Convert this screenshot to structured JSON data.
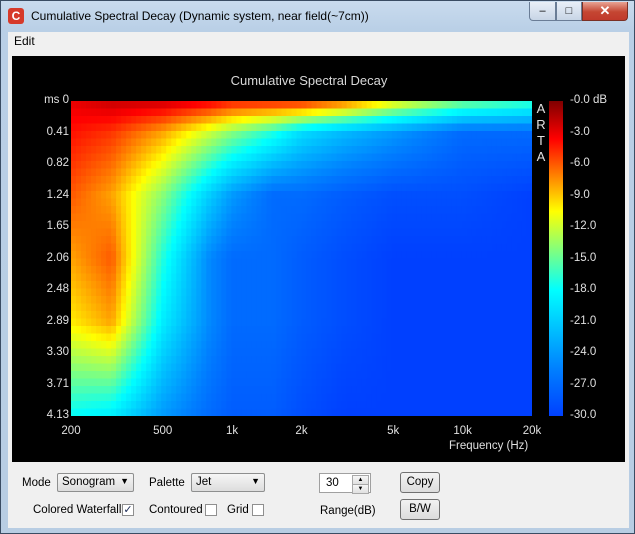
{
  "window": {
    "title": "Cumulative Spectral Decay  (Dynamic system, near field(~7cm))"
  },
  "menu": {
    "edit": "Edit"
  },
  "chart_data": {
    "type": "heatmap",
    "title": "Cumulative Spectral Decay",
    "xlabel": "Frequency (Hz)",
    "ylabel": "ms",
    "x_scale": "log",
    "xlim": [
      200,
      20000
    ],
    "ylim": [
      0,
      4.13
    ],
    "x_ticks": [
      "200",
      "500",
      "1k",
      "2k",
      "5k",
      "10k",
      "20k"
    ],
    "y_ticks": [
      "ms 0",
      "0.41",
      "0.82",
      "1.24",
      "1.65",
      "2.06",
      "2.48",
      "2.89",
      "3.30",
      "3.71",
      "4.13"
    ],
    "colorbar_ticks": [
      "-0.0 dB",
      "-3.0",
      "-6.0",
      "-9.0",
      "-12.0",
      "-15.0",
      "-18.0",
      "-21.0",
      "-24.0",
      "-27.0",
      "-30.0"
    ],
    "colorbar_range_db": [
      -30,
      0
    ],
    "palette": "Jet",
    "watermark": "ARTA",
    "approx_levels_db": {
      "note_hz": [
        200,
        300,
        500,
        800,
        1000,
        1500,
        2000,
        3000,
        5000,
        10000,
        20000
      ],
      "t_0.0ms": [
        -3,
        -2,
        -2,
        -3,
        -4,
        -4,
        -4,
        -6,
        -10,
        -14,
        -16
      ],
      "t_0.41ms": [
        -4,
        -5,
        -8,
        -12,
        -14,
        -17,
        -20,
        -22,
        -24,
        -27,
        -27
      ],
      "t_1.24ms": [
        -6,
        -8,
        -14,
        -21,
        -24,
        -27,
        -27,
        -28,
        -29,
        -29,
        -30
      ],
      "t_2.06ms": [
        -8,
        -6,
        -17,
        -25,
        -27,
        -27,
        -28,
        -29,
        -30,
        -30,
        -30
      ],
      "t_2.89ms": [
        -10,
        -8,
        -19,
        -25,
        -27,
        -27,
        -28,
        -29,
        -30,
        -30,
        -30
      ],
      "t_4.13ms": [
        -18,
        -19,
        -24,
        -27,
        -28,
        -28,
        -29,
        -30,
        -30,
        -30,
        -30
      ]
    }
  },
  "controls": {
    "mode_label": "Mode",
    "mode_value": "Sonogram",
    "palette_label": "Palette",
    "palette_value": "Jet",
    "range_value": "30",
    "range_label": "Range(dB)",
    "copy_label": "Copy",
    "bw_label": "B/W",
    "colored_waterfall_label": "Colored Waterfall",
    "colored_waterfall_checked": true,
    "contoured_label": "Contoured",
    "contoured_checked": false,
    "grid_label": "Grid",
    "grid_checked": false
  }
}
